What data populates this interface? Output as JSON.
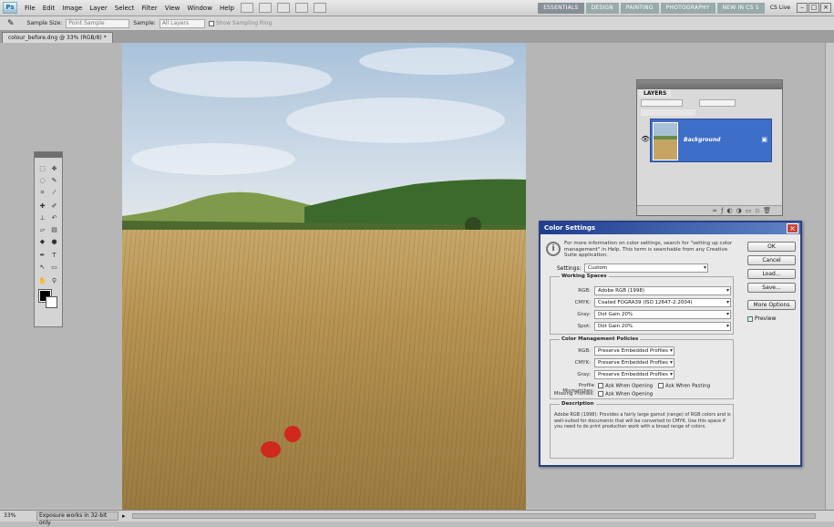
{
  "menubar": {
    "logo": "Ps",
    "items": [
      "File",
      "Edit",
      "Image",
      "Layer",
      "Select",
      "Filter",
      "View",
      "Window",
      "Help"
    ],
    "workspaces": [
      "ESSENTIALS",
      "DESIGN",
      "PAINTING",
      "PHOTOGRAPHY",
      "NEW IN CS 5"
    ],
    "cs_live": "CS Live"
  },
  "options": {
    "sample_size_label": "Sample Size:",
    "sample_size_value": "Point Sample",
    "sample_label": "Sample:",
    "sample_value": "All Layers",
    "show_ring": "Show Sampling Ring"
  },
  "document": {
    "tab": "colour_before.dng @ 33% (RGB/8) *",
    "zoom": "33%",
    "status": "Exposure works in 32-bit only"
  },
  "layers": {
    "title": "LAYERS",
    "layer_name": "Background"
  },
  "dialog": {
    "title": "Color Settings",
    "info": "For more information on color settings, search for \"setting up color management\" in Help. This term is searchable from any Creative Suite application.",
    "settings_label": "Settings:",
    "settings_value": "Custom",
    "buttons": {
      "ok": "OK",
      "cancel": "Cancel",
      "load": "Load...",
      "save": "Save...",
      "more": "More Options"
    },
    "preview": "Preview",
    "working_spaces": {
      "title": "Working Spaces",
      "rgb_label": "RGB:",
      "rgb": "Adobe RGB (1998)",
      "cmyk_label": "CMYK:",
      "cmyk": "Coated FOGRA39 (ISO 12647-2:2004)",
      "gray_label": "Gray:",
      "gray": "Dot Gain 20%",
      "spot_label": "Spot:",
      "spot": "Dot Gain 20%"
    },
    "policies": {
      "title": "Color Management Policies",
      "rgb_label": "RGB:",
      "rgb": "Preserve Embedded Profiles",
      "cmyk_label": "CMYK:",
      "cmyk": "Preserve Embedded Profiles",
      "gray_label": "Gray:",
      "gray": "Preserve Embedded Profiles",
      "mismatch_label": "Profile Mismatches:",
      "ask_open": "Ask When Opening",
      "ask_paste": "Ask When Pasting",
      "missing_label": "Missing Profiles:",
      "ask_open2": "Ask When Opening"
    },
    "description": {
      "title": "Description",
      "text": "Adobe RGB (1998): Provides a fairly large gamut (range) of RGB colors and is well-suited for documents that will be converted to CMYK. Use this space if you need to do print production work with a broad range of colors."
    }
  }
}
